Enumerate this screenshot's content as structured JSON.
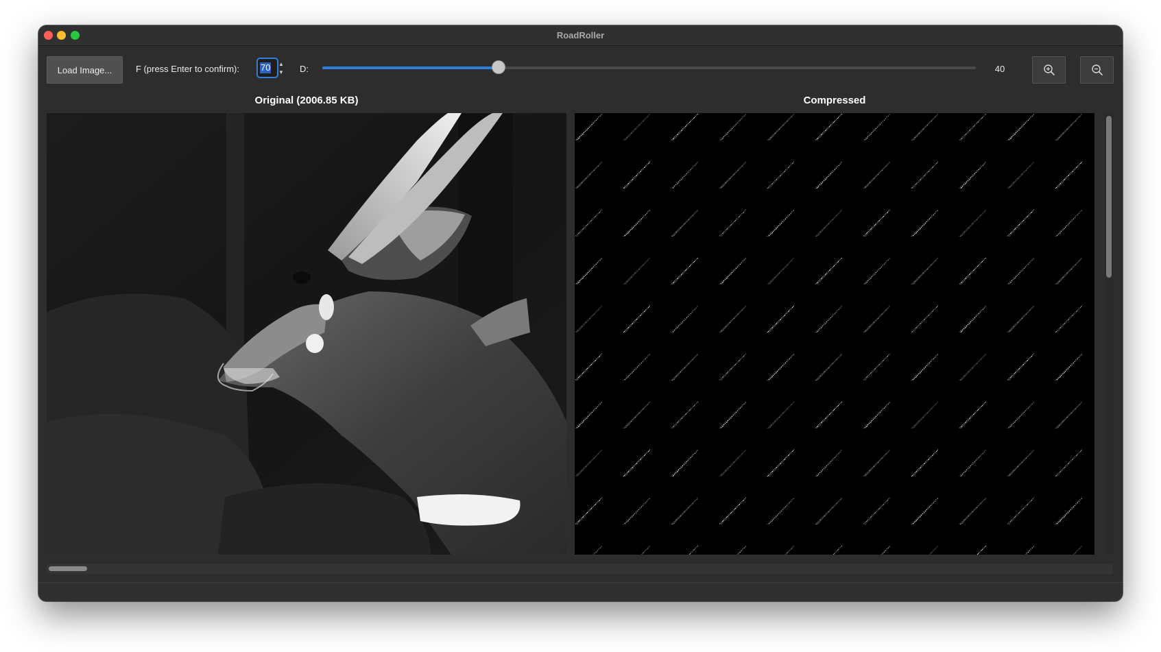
{
  "window": {
    "title": "RoadRoller"
  },
  "toolbar": {
    "load_button_label": "Load Image...",
    "f_label": "F (press Enter to confirm):",
    "f_value": "70",
    "d_label": "D:",
    "d_value": "40",
    "d_slider_fraction": 0.27,
    "accent_color": "#2f7fdc",
    "zoom_in_icon": "zoom-in-icon",
    "zoom_out_icon": "zoom-out-icon"
  },
  "panels": {
    "original_title": "Original (2006.85 KB)",
    "compressed_title": "Compressed"
  },
  "compressed_preview": {
    "columns": 11,
    "rows": 10
  }
}
